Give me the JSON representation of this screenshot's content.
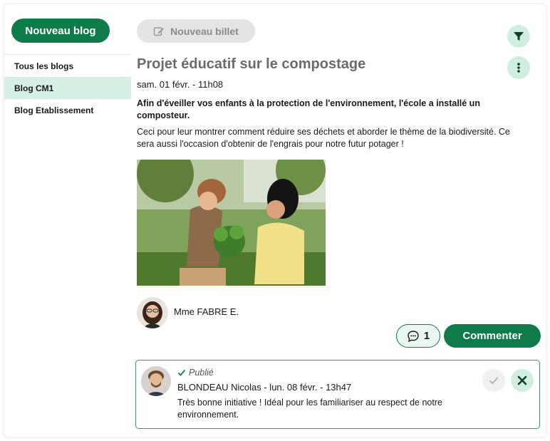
{
  "sidebar": {
    "new_blog_label": "Nouveau blog",
    "items": [
      {
        "label": "Tous les blogs"
      },
      {
        "label": "Blog CM1"
      },
      {
        "label": "Blog Etablissement"
      }
    ]
  },
  "toolbar": {
    "new_post_label": "Nouveau billet",
    "filter_icon": "filter-icon",
    "more_icon": "more-vertical-icon"
  },
  "post": {
    "title": "Projet éducatif sur le compostage",
    "date": "sam. 01 févr. - 11h08",
    "lead": "Afin d'éveiller vos enfants à la protection de l'environnement, l'école a installé un composteur.",
    "body": "Ceci pour leur montrer comment réduire ses déchets et aborder le thème de la biodiversité. Ce sera aussi l'occasion d'obtenir de l'engrais pour notre futur potager !",
    "author": "Mme FABRE E.",
    "comment_count": "1",
    "comment_button_label": "Commenter"
  },
  "comment": {
    "status": "Publié",
    "meta": "BLONDEAU Nicolas - lun. 08 févr. - 13h47",
    "text": "Très bonne initiative !  Idéal pour les familiariser au respect de notre environnement."
  },
  "colors": {
    "primary": "#0f7a4a",
    "primary_light": "#cfeee0",
    "active_item": "#d5efe3",
    "disabled_button": "#e4e4e4"
  }
}
